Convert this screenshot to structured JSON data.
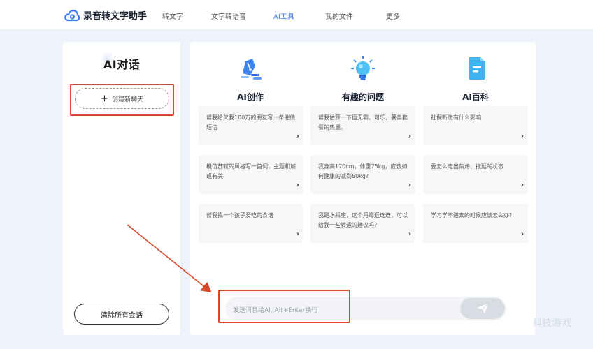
{
  "app": {
    "name": "录音转文字助手"
  },
  "nav": {
    "items": [
      {
        "label": "转文字"
      },
      {
        "label": "文字转语音"
      },
      {
        "label": "AI工具"
      },
      {
        "label": "我的文件"
      },
      {
        "label": "更多"
      }
    ],
    "active_index": 2
  },
  "sidebar": {
    "title": "AI对话",
    "new_chat_label": "创建新聊天",
    "clear_label": "清除所有会话"
  },
  "categories": [
    {
      "label": "AI创作",
      "icon": "pen-nib-icon"
    },
    {
      "label": "有趣的问题",
      "icon": "lightbulb-icon"
    },
    {
      "label": "AI百科",
      "icon": "document-icon"
    }
  ],
  "cards": [
    [
      "帮我给欠我100万的朋友写一条催债短信",
      "帮我估算一下巨无霸、可乐、薯条套餐的热量。",
      "社保断缴有什么影响"
    ],
    [
      "模仿苏轼的风格写一首词，主题和加班有关",
      "我身高170cm，体重75kg，应该如何健康的减到60kg?",
      "要怎么走出焦虑、拖延的状态"
    ],
    [
      "帮我找一个孩子爱吃的食谱",
      "我是水瓶座，这个月霉运连连，可以给我一些转运的建议吗?",
      "学习学不进去的时候应该怎么办?"
    ]
  ],
  "input": {
    "placeholder": "发送消息给AI, Alt+Enter换行"
  },
  "watermark": "科技游戏",
  "colors": {
    "accent": "#3d7bf7",
    "highlight_box": "#d9472b",
    "background": "#eef3fb"
  }
}
